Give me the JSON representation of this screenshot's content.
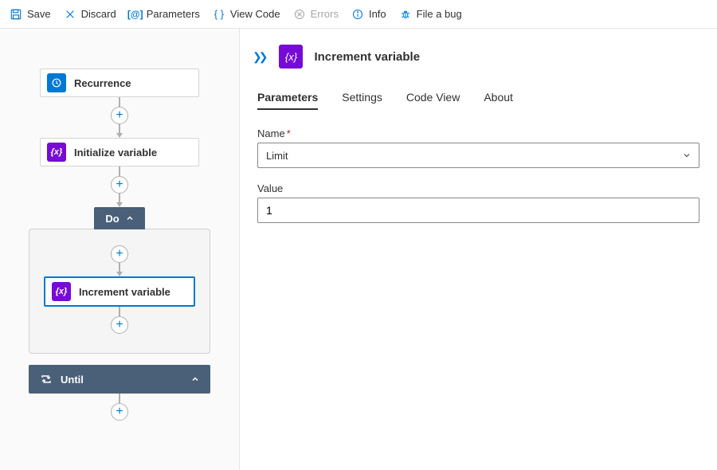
{
  "toolbar": {
    "save": "Save",
    "discard": "Discard",
    "parameters": "Parameters",
    "viewCode": "View Code",
    "errors": "Errors",
    "info": "Info",
    "bug": "File a bug"
  },
  "workflow": {
    "recurrence": "Recurrence",
    "initialize": "Initialize variable",
    "doLabel": "Do",
    "increment": "Increment variable",
    "untilLabel": "Until"
  },
  "panel": {
    "title": "Increment variable",
    "tabs": {
      "parameters": "Parameters",
      "settings": "Settings",
      "codeView": "Code View",
      "about": "About"
    },
    "fields": {
      "nameLabel": "Name",
      "nameValue": "Limit",
      "valueLabel": "Value",
      "valueValue": "1"
    }
  }
}
